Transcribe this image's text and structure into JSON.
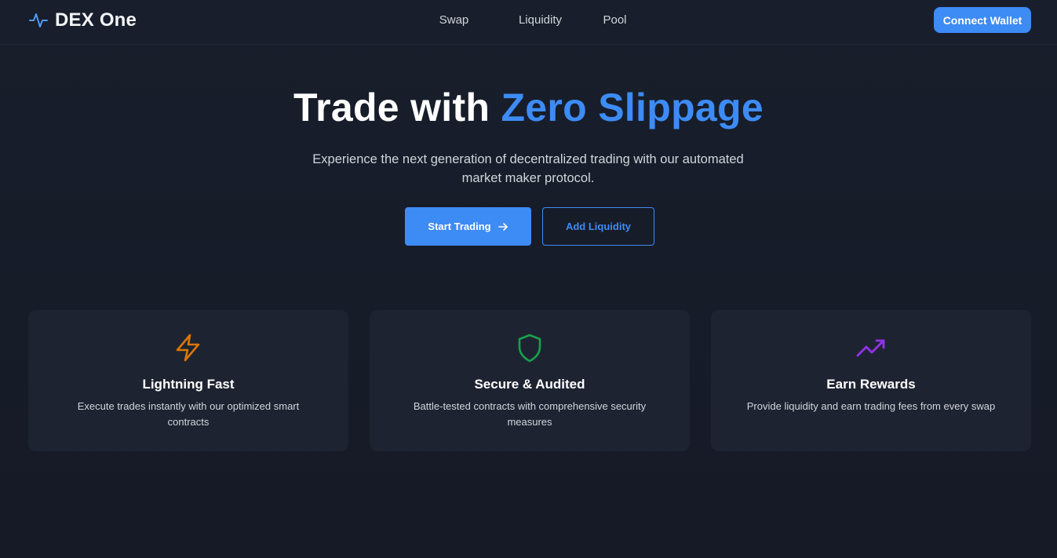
{
  "header": {
    "logo_text": "DEX One",
    "nav": [
      "Swap",
      "Liquidity",
      "Pool"
    ],
    "connect_label": "Connect Wallet"
  },
  "hero": {
    "title_plain": "Trade with ",
    "title_accent": "Zero Slippage",
    "subtitle": "Experience the next generation of decentralized trading with our automated market maker protocol.",
    "primary_label": "Start Trading",
    "secondary_label": "Add Liquidity"
  },
  "features": [
    {
      "icon": "lightning-icon",
      "icon_color": "#d97706",
      "title": "Lightning Fast",
      "desc": "Execute trades instantly with our optimized smart contracts"
    },
    {
      "icon": "shield-icon",
      "icon_color": "#16a34a",
      "title": "Secure & Audited",
      "desc": "Battle-tested contracts with comprehensive security measures"
    },
    {
      "icon": "trending-up-icon",
      "icon_color": "#9333ea",
      "title": "Earn Rewards",
      "desc": "Provide liquidity and earn trading fees from every swap"
    }
  ],
  "colors": {
    "accent": "#3d8bf5",
    "background": "#161b27",
    "card": "#1e2331"
  }
}
